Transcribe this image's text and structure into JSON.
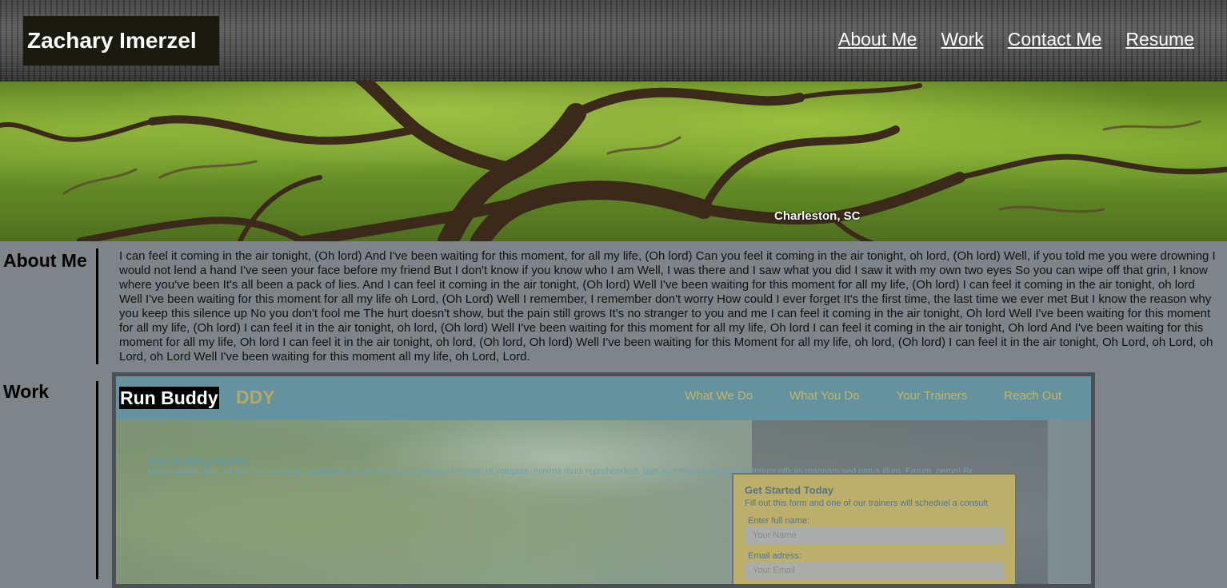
{
  "header": {
    "site_title": "Zachary Imerzel",
    "nav": [
      {
        "label": "About Me"
      },
      {
        "label": "Work"
      },
      {
        "label": "Contact Me"
      },
      {
        "label": "Resume"
      }
    ]
  },
  "hero": {
    "caption": "Charleston, SC"
  },
  "about": {
    "title": "About Me",
    "text": "I can feel it coming in the air tonight, (Oh lord) And I've been waiting for this moment, for all my life, (Oh lord) Can you feel it coming in the air tonight, oh lord, (Oh lord) Well, if you told me you were drowning I would not lend a hand I've seen your face before my friend But I don't know if you know who I am Well, I was there and I saw what you did I saw it with my own two eyes So you can wipe off that grin, I know where you've been It's all been a pack of lies. And I can feel it coming in the air tonight, (Oh lord) Well I've been waiting for this moment for all my life, (Oh lord) I can feel it coming in the air tonight, oh lord Well I've been waiting for this moment for all my life oh Lord, (Oh Lord) Well I remember, I remember don't worry How could I ever forget It's the first time, the last time we ever met But I know the reason why you keep this silence up No you don't fool me The hurt doesn't show, but the pain still grows It's no stranger to you and me I can feel it coming in the air tonight, Oh lord Well I've been waiting for this moment for all my life, (Oh lord) I can feel it in the air tonight, oh lord, (Oh lord) Well I've been waiting for this moment for all my life, Oh lord I can feel it coming in the air tonight, Oh lord And I've been waiting for this moment for all my life, Oh lord I can feel it in the air tonight, oh lord, (Oh lord, Oh lord) Well I've been waiting for this Moment for all my life, oh lord, (Oh lord) I can feel it in the air tonight, Oh Lord, oh Lord, oh Lord, oh Lord Well I've been waiting for this moment all my life, oh Lord, Lord."
  },
  "work": {
    "title": "Work",
    "project": {
      "label": "Run Buddy",
      "brand_partial": "DDY",
      "nav": [
        "What We Do",
        "What You Do",
        "Your Trainers",
        "Reach Out"
      ],
      "heading": "Start Building Habbits",
      "blurb": "Lorem ipsum dolor sit amet consectetur adipisicing elit. Molestias repellendus nostrum ut voluptas, minima modi reprehenderit, quis architecto rerum praesentium officiis magnam sed natus illum. Earum, nemo! Rem, perferendis.",
      "form": {
        "title": "Get Started Today",
        "subtitle": "Fill out this form and one of our trainers will scheduel a consult",
        "name_label": "Enter full name:",
        "name_placeholder": "Your Name",
        "email_label": "Email adress:",
        "email_placeholder": "Your Email"
      }
    }
  },
  "colors": {
    "page_bg": "#7f8489",
    "title_bg": "#1a1a0e",
    "project_nav": "#5e97a6",
    "project_accent": "#d8c45e",
    "form_bg": "#cdbc63"
  }
}
